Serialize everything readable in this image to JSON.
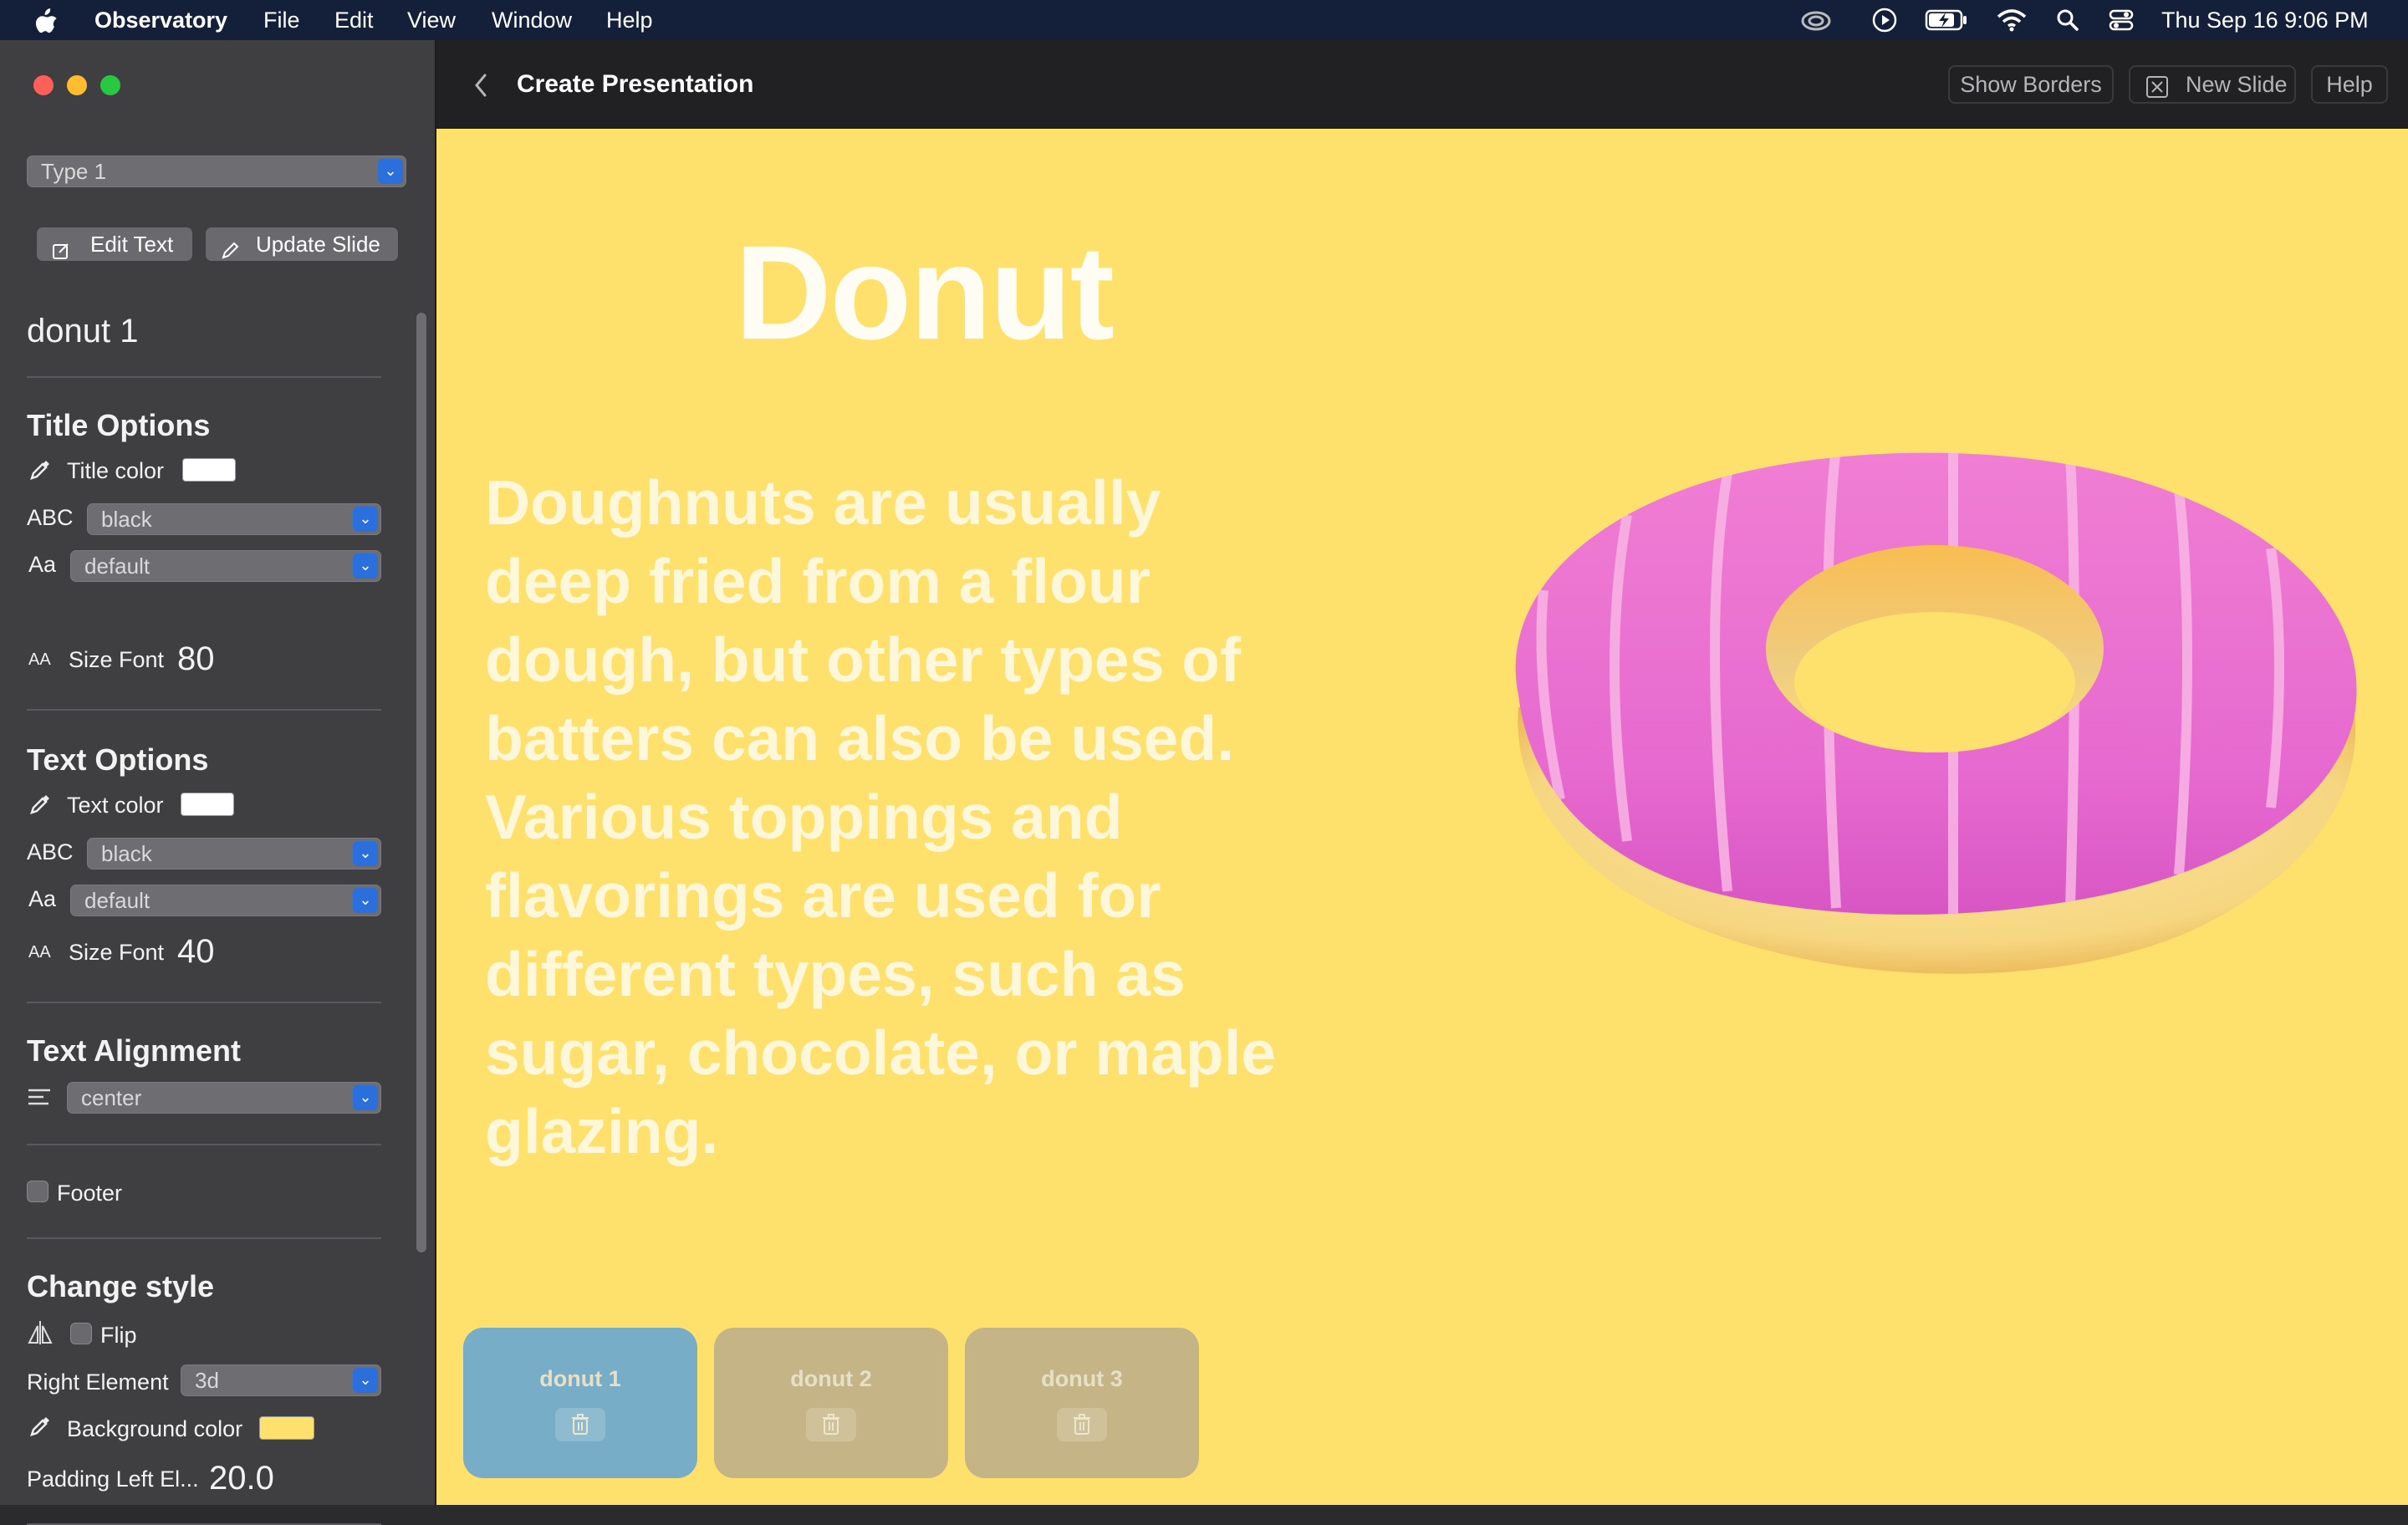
{
  "menubar": {
    "app_name": "Observatory",
    "menus": [
      "File",
      "Edit",
      "View",
      "Window",
      "Help"
    ],
    "clock": "Thu Sep 16  9:06 PM",
    "status_icons": [
      "creative-cloud-icon",
      "play-icon",
      "battery-charging-icon",
      "wifi-icon",
      "search-icon",
      "control-center-icon"
    ]
  },
  "toolbar": {
    "title": "Create Presentation",
    "buttons": {
      "show_borders": "Show Borders",
      "new_slide": "New Slide",
      "help": "Help"
    }
  },
  "sidebar": {
    "type_select": "Type 1",
    "edit_text": "Edit Text",
    "update_slide": "Update Slide",
    "slide_name": "donut 1",
    "title_options": {
      "heading": "Title Options",
      "color_label": "Title color",
      "color": "#ffffff",
      "abc_label": "ABC",
      "abc_value": "black",
      "aa_label": "Aa",
      "font_value": "default",
      "size_icon_label": "AA",
      "size_label": "Size Font",
      "size_value": "80"
    },
    "text_options": {
      "heading": "Text Options",
      "color_label": "Text color",
      "color": "#ffffff",
      "abc_label": "ABC",
      "abc_value": "black",
      "aa_label": "Aa",
      "font_value": "default",
      "size_icon_label": "AA",
      "size_label": "Size Font",
      "size_value": "40"
    },
    "text_alignment": {
      "heading": "Text Alignment",
      "value": "center"
    },
    "footer_label": "Footer",
    "change_style": {
      "heading": "Change style",
      "flip_label": "Flip",
      "right_element_label": "Right Element",
      "right_element_value": "3d",
      "bg_color_label": "Background color",
      "bg_color": "#fde16c",
      "padding_label": "Padding Left El...",
      "padding_value": "20.0"
    }
  },
  "slide": {
    "title": "Donut",
    "body_lines": [
      "Doughnuts are usually",
      "deep fried from a flour",
      "dough, but other types of",
      "batters can also be used.",
      "Various toppings and",
      "flavorings are used for",
      "different types, such as",
      "sugar, chocolate, or maple",
      "glazing."
    ],
    "background": "#fde16c",
    "thumbnails": [
      "donut 1",
      "donut 2",
      "donut 3"
    ],
    "selected_thumbnail": "donut 1"
  }
}
